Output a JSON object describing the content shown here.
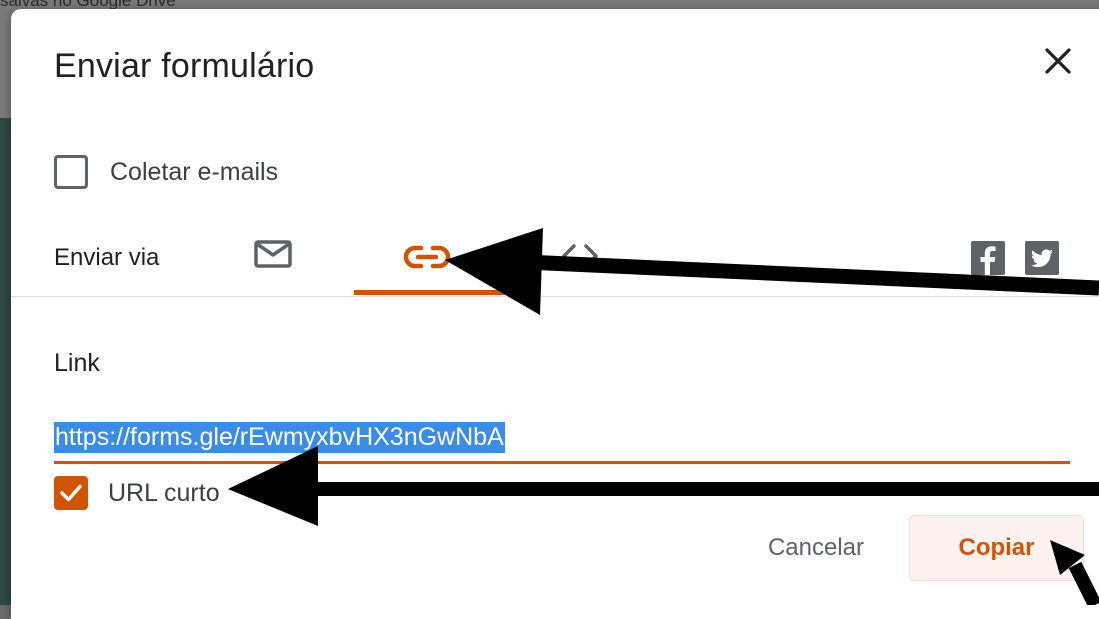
{
  "background": {
    "partial_text": "salvas no Google Drive"
  },
  "dialog": {
    "title": "Enviar formulário",
    "close_icon": "close-icon",
    "collect_emails": {
      "label": "Coletar e-mails",
      "checked": false
    },
    "send_via": {
      "label": "Enviar via",
      "tabs": [
        {
          "icon": "email-icon",
          "selected": false
        },
        {
          "icon": "link-icon",
          "selected": true
        },
        {
          "icon": "embed-icon",
          "selected": false
        }
      ],
      "share": [
        {
          "icon": "facebook-icon"
        },
        {
          "icon": "twitter-icon"
        }
      ]
    },
    "link": {
      "label": "Link",
      "url": "https://forms.gle/rEwmyxbvHX3nGwNbA",
      "short_url": {
        "label": "URL curto",
        "checked": true
      }
    },
    "buttons": {
      "cancel": "Cancelar",
      "copy": "Copiar"
    }
  },
  "colors": {
    "accent": "#d35400",
    "selection": "#3b8ce8",
    "annotation_arrows": "#000000"
  }
}
